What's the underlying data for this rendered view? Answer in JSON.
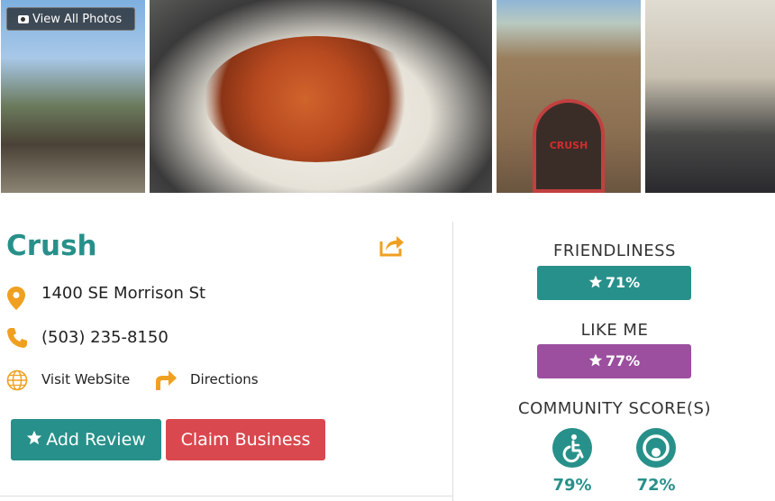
{
  "photos": {
    "view_all_label": "View All Photos",
    "storefront_sign": "CRUSH"
  },
  "business": {
    "name": "Crush",
    "address": "1400 SE Morrison St",
    "phone": "(503) 235-8150",
    "website_label": "Visit WebSite",
    "directions_label": "Directions"
  },
  "actions": {
    "add_review": "Add Review",
    "claim_business": "Claim Business"
  },
  "scores": {
    "friendliness_label": "FRIENDLINESS",
    "friendliness_value": "71%",
    "like_me_label": "LIKE ME",
    "like_me_value": "77%",
    "community_label": "COMMUNITY SCORE(S)",
    "accessibility_value": "79%",
    "other_value": "72%"
  },
  "colors": {
    "teal": "#28908a",
    "purple": "#9b4f9e",
    "red": "#d9484f",
    "orange": "#f0a020"
  },
  "icons": [
    "camera-icon",
    "share-icon",
    "map-pin-icon",
    "phone-icon",
    "globe-icon",
    "directions-arrow-icon",
    "star-icon",
    "wheelchair-icon",
    "circle-target-icon"
  ]
}
